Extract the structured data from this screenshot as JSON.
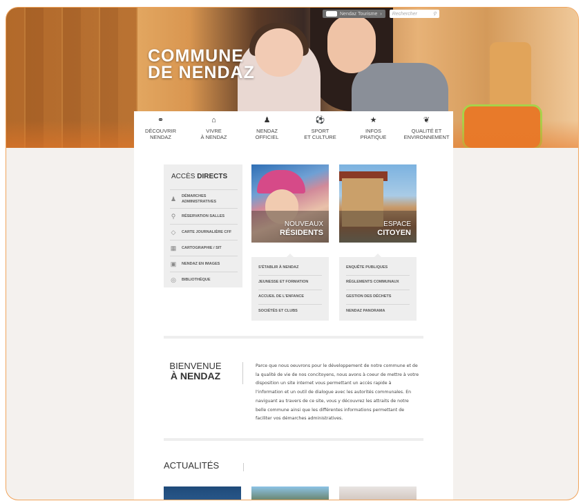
{
  "brand": {
    "logo_line1": "COMMUNE",
    "logo_line2": "DE NENDAZ"
  },
  "top_tools": {
    "tourisme_label": "Nendaz Tourisme",
    "search_placeholder": "Rechercher"
  },
  "nav": {
    "items": [
      {
        "icon": "binoculars-icon",
        "glyph": "⚭",
        "label": "Découvrir\nNendaz"
      },
      {
        "icon": "house-icon",
        "glyph": "⌂",
        "label": "Vivre\nà Nendaz"
      },
      {
        "icon": "person-icon",
        "glyph": "♟",
        "label": "Nendaz\nofficiel"
      },
      {
        "icon": "ball-icon",
        "glyph": "⚽",
        "label": "Sport\net culture"
      },
      {
        "icon": "star-icon",
        "glyph": "★",
        "label": "Infos\npratique"
      },
      {
        "icon": "leaf-icon",
        "glyph": "❦",
        "label": "Qualité et\nenvironnement"
      }
    ]
  },
  "access": {
    "title_light": "ACCÈS",
    "title_bold": "DIRECTS",
    "items": [
      {
        "icon": "person-icon",
        "glyph": "♟",
        "label": "Démarches administratives"
      },
      {
        "icon": "key-icon",
        "glyph": "⚲",
        "label": "Réservation salles"
      },
      {
        "icon": "ticket-icon",
        "glyph": "◇",
        "label": "Carte journalière CFF"
      },
      {
        "icon": "map-icon",
        "glyph": "▦",
        "label": "Cartographie / SIT"
      },
      {
        "icon": "image-icon",
        "glyph": "▣",
        "label": "Nendaz en images"
      },
      {
        "icon": "book-icon",
        "glyph": "◎",
        "label": "Bibliothèque"
      }
    ]
  },
  "tiles": [
    {
      "line1": "NOUVEAUX",
      "line2": "RÉSIDENTS"
    },
    {
      "line1": "ESPACE",
      "line2": "CITOYEN"
    }
  ],
  "residents_links": [
    "S'établir à Nendaz",
    "Jeunesse et formation",
    "Accueil de l'enfance",
    "Sociétés et clubs"
  ],
  "citoyen_links": [
    "Enquête publiques",
    "Règlements communaux",
    "Gestion des déchets",
    "Nendaz Panorama"
  ],
  "welcome": {
    "title_line1": "BIENVENUE",
    "title_line2": "À NENDAZ",
    "text": "Parce que nous oeuvrons pour le développement de notre commune et de la qualité de vie de nos concitoyens, nous avons à coeur de mettre à votre disposition un site internet vous permettant un accès rapide à l'information et un outil de dialogue avec les autorités communales. En naviguant au travers de ce site, vous y découvrez les attraits de notre belle commune ainsi que les différentes informations permettant de faciliter vos démarches administratives."
  },
  "news": {
    "title": "ACTUALITÉS"
  }
}
